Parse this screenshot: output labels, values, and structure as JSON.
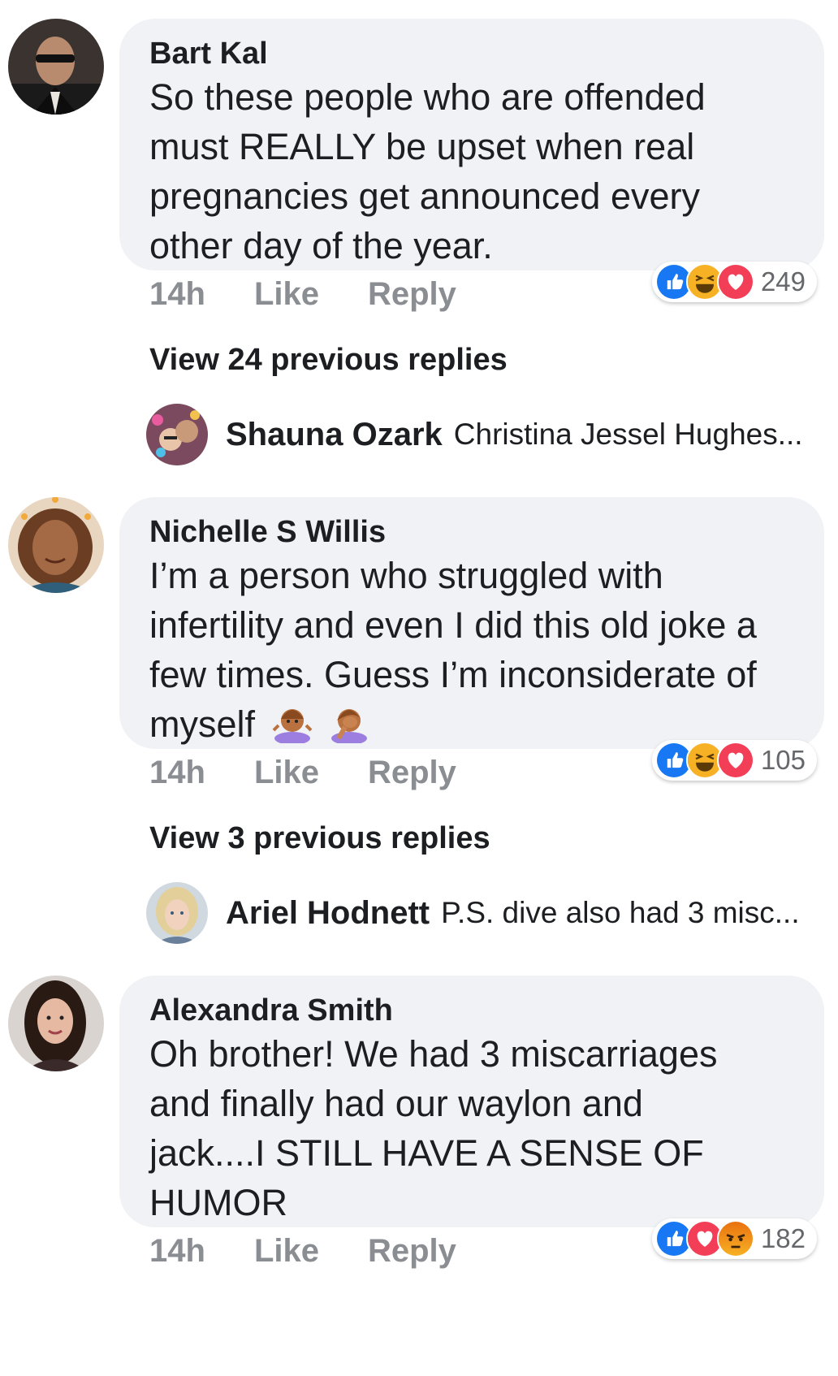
{
  "comments": [
    {
      "author": "Bart Kal",
      "text": "So these people who are offended must REALLY be upset when real pregnancies get announced every other day of the year.",
      "time": "14h",
      "like_label": "Like",
      "reply_label": "Reply",
      "reaction_icons": [
        "like-icon",
        "haha-icon",
        "love-icon"
      ],
      "reaction_count": "249",
      "view_replies": "View 24 previous replies",
      "latest_reply": {
        "author": "Shauna Ozark",
        "snippet": "Christina Jessel Hughes..."
      }
    },
    {
      "author": "Nichelle S Willis",
      "text": "I’m a person who struggled with infertility and even I did this old joke a few times. Guess I’m inconsiderate of myself",
      "emojis": [
        "shrug-woman-emoji",
        "facepalm-woman-emoji"
      ],
      "time": "14h",
      "like_label": "Like",
      "reply_label": "Reply",
      "reaction_icons": [
        "like-icon",
        "haha-icon",
        "love-icon"
      ],
      "reaction_count": "105",
      "view_replies": "View 3 previous replies",
      "latest_reply": {
        "author": "Ariel Hodnett",
        "snippet": "P.S. dive also had 3 misc..."
      }
    },
    {
      "author": "Alexandra Smith",
      "text": "Oh brother! We had 3 miscarriages and finally had our waylon and jack....I STILL HAVE A SENSE OF HUMOR",
      "time": "14h",
      "like_label": "Like",
      "reply_label": "Reply",
      "reaction_icons": [
        "like-icon",
        "love-icon",
        "angry-icon"
      ],
      "reaction_count": "182"
    }
  ],
  "colors": {
    "bubble": "#f0f2f5",
    "like_blue": "#1877f2",
    "love_red": "#f33e58",
    "haha_yellow": "#f7b125",
    "muted_text": "#8a8d91"
  }
}
